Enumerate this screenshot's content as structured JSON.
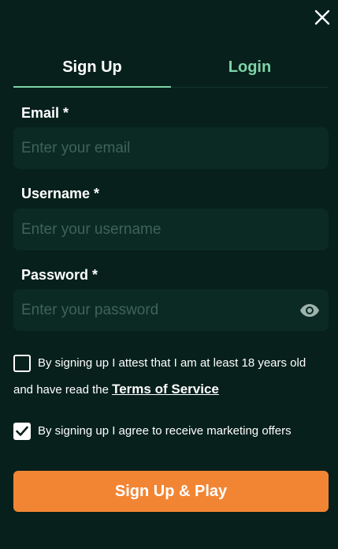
{
  "tabs": {
    "signup_label": "Sign Up",
    "login_label": "Login"
  },
  "form": {
    "email": {
      "label": "Email *",
      "placeholder": "Enter your email",
      "value": ""
    },
    "username": {
      "label": "Username *",
      "placeholder": "Enter your username",
      "value": ""
    },
    "password": {
      "label": "Password *",
      "placeholder": "Enter your password",
      "value": ""
    }
  },
  "age_check": {
    "checked": false,
    "text_line1": "By signing up I attest that I am at least 18 years old",
    "text_line2_prefix": "and have read the ",
    "terms_link": "Terms of Service"
  },
  "marketing_check": {
    "checked": true,
    "text": "By signing up I agree to receive marketing offers"
  },
  "submit": {
    "label": "Sign Up & Play"
  },
  "icons": {
    "close": "close-icon",
    "eye": "eye-icon",
    "checkmark": "checkmark-icon"
  },
  "colors": {
    "background": "#07201b",
    "input_background": "#0b2a23",
    "accent_green": "#7fd3a7",
    "submit_orange": "#f28534",
    "placeholder": "#3f6258"
  }
}
